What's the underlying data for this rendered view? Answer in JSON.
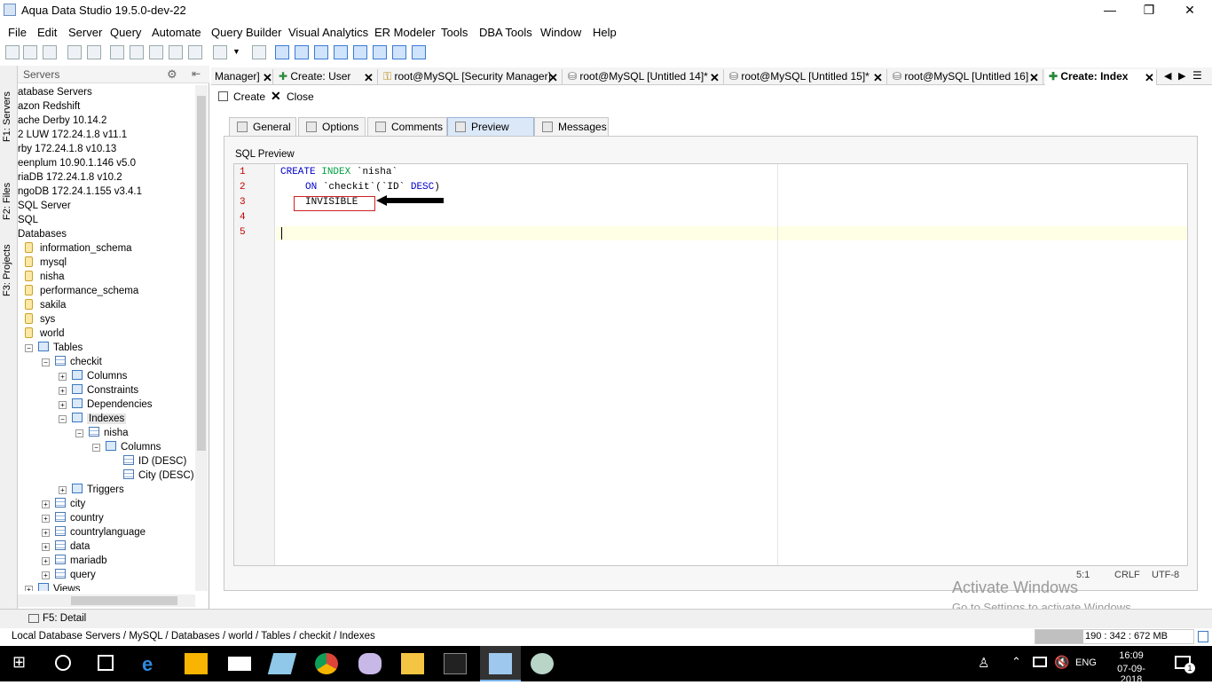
{
  "window": {
    "title": "Aqua Data Studio 19.5.0-dev-22",
    "min": "—",
    "max": "❐",
    "close": "✕"
  },
  "menu": [
    "File",
    "Edit",
    "Server",
    "Query",
    "Automate",
    "Query Builder",
    "Visual Analytics",
    "ER Modeler",
    "Tools",
    "DBA Tools",
    "Window",
    "Help"
  ],
  "left_tabs": {
    "servers": "F1: Servers",
    "files": "F2: Files",
    "projects": "F3: Projects"
  },
  "servers_panel": {
    "title": "Servers"
  },
  "tree": [
    {
      "label": "atabase Servers"
    },
    {
      "label": "azon Redshift"
    },
    {
      "label": "ache Derby 10.14.2"
    },
    {
      "label": "2 LUW 172.24.1.8 v11.1"
    },
    {
      "label": "rby 172.24.1.8 v10.13"
    },
    {
      "label": "eenplum 10.90.1.146 v5.0"
    },
    {
      "label": "riaDB 172.24.1.8 v10.2"
    },
    {
      "label": "ngoDB 172.24.1.155 v3.4.1"
    },
    {
      "label": " SQL Server"
    },
    {
      "label": "SQL"
    },
    {
      "label": " Databases"
    },
    {
      "label": "information_schema"
    },
    {
      "label": "mysql"
    },
    {
      "label": "nisha"
    },
    {
      "label": "performance_schema"
    },
    {
      "label": "sakila"
    },
    {
      "label": "sys"
    },
    {
      "label": "world"
    },
    {
      "label": "Tables"
    },
    {
      "label": "checkit"
    },
    {
      "label": "Columns"
    },
    {
      "label": "Constraints"
    },
    {
      "label": "Dependencies"
    },
    {
      "label": "Indexes"
    },
    {
      "label": "nisha"
    },
    {
      "label": "Columns"
    },
    {
      "label": "ID (DESC)"
    },
    {
      "label": "City (DESC)"
    },
    {
      "label": "Triggers"
    },
    {
      "label": "city"
    },
    {
      "label": "country"
    },
    {
      "label": "countrylanguage"
    },
    {
      "label": "data"
    },
    {
      "label": "mariadb"
    },
    {
      "label": "query"
    },
    {
      "label": "Views"
    }
  ],
  "doc_tabs": [
    "Manager]",
    "Create: User",
    "root@MySQL [Security Manager]",
    "root@MySQL [Untitled 14]*",
    "root@MySQL [Untitled 15]*",
    "root@MySQL [Untitled 16]",
    "Create: Index"
  ],
  "actions": {
    "create": "Create",
    "close": "Close"
  },
  "inner_tabs": [
    "General",
    "Options",
    "Comments",
    "Preview SQL",
    "Messages"
  ],
  "sql_preview": {
    "label": "SQL Preview",
    "lines": [
      "1",
      "2",
      "3",
      "4",
      "5"
    ],
    "code": {
      "l1_kw1": "CREATE",
      "l1_kw2": "INDEX",
      "l1_rest": "`nisha`",
      "l2_kw": "ON",
      "l2_mid": "`checkit`(`ID`",
      "l2_kw2": "DESC",
      "l2_end": ")",
      "l3": "INVISIBLE"
    }
  },
  "editor_status": {
    "pos": "5:1",
    "eol": "CRLF",
    "enc": "UTF-8"
  },
  "detail_tab": "F5: Detail",
  "path": "Local Database Servers / MySQL / Databases / world / Tables / checkit / Indexes",
  "memory": "190 : 342 : 672 MB",
  "watermark": {
    "line1": "Activate Windows",
    "line2": "Go to Settings to activate Windows."
  },
  "taskbar": {
    "lang": "ENG",
    "time": "16:09",
    "date": "07-09-2018",
    "notif": "1"
  }
}
